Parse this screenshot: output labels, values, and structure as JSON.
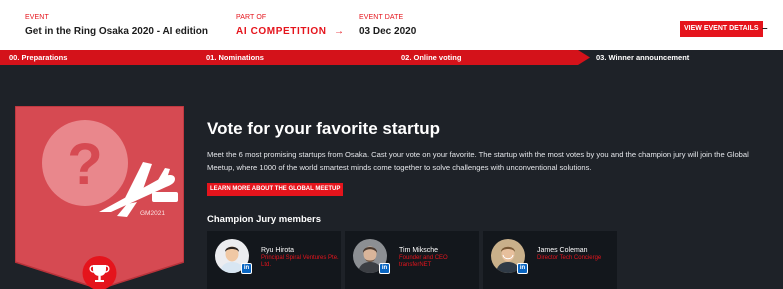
{
  "event": {
    "label": "EVENT",
    "name": "Get in the Ring Osaka 2020 - AI edition",
    "part_of_label": "PART OF",
    "part_of": "AI COMPETITION",
    "part_of_arrow": "→",
    "date_label": "EVENT DATE",
    "date": "03 Dec 2020",
    "details_button": "VIEW EVENT DETAILS",
    "more_icon": "dash-icon",
    "more_glyph": "–"
  },
  "stages": [
    {
      "label": "00. Preparations",
      "active": false
    },
    {
      "label": "01. Nominations",
      "active": false
    },
    {
      "label": "02. Online voting",
      "active": false
    },
    {
      "label": "03. Winner announcement",
      "active": true
    }
  ],
  "badge": {
    "year": "GM2021",
    "icons": [
      "question-mark-icon",
      "airplane-icon",
      "trophy-icon"
    ],
    "colors": {
      "shield": "#d64a52",
      "circle": "#ffffff"
    }
  },
  "main": {
    "title": "Vote for your favorite startup",
    "description": "Meet the 6 most promising startups from Osaka. Cast your vote on your favorite. The startup with the most votes by you and the champion jury will join the Global Meetup, where 1000 of the world smartest minds come together to solve challenges with unconventional solutions.",
    "learn_more": "LEARN MORE ABOUT THE GLOBAL MEETUP",
    "jury_title": "Champion Jury members"
  },
  "jury": [
    {
      "name": "Ryu Hirota",
      "role": "Principal Spiral Ventures Pte. Ltd.",
      "social": "linkedin-icon",
      "social_glyph": "in"
    },
    {
      "name": "Tim Miksche",
      "role": "Founder and CEO transferNET",
      "social": "linkedin-icon",
      "social_glyph": "in"
    },
    {
      "name": "James Coleman",
      "role": "Director Tech Concierge",
      "social": "linkedin-icon",
      "social_glyph": "in"
    }
  ],
  "colors": {
    "accent": "#e5141c",
    "background": "#1e2228",
    "card": "#13171c",
    "linkedin": "#0a66c2"
  }
}
